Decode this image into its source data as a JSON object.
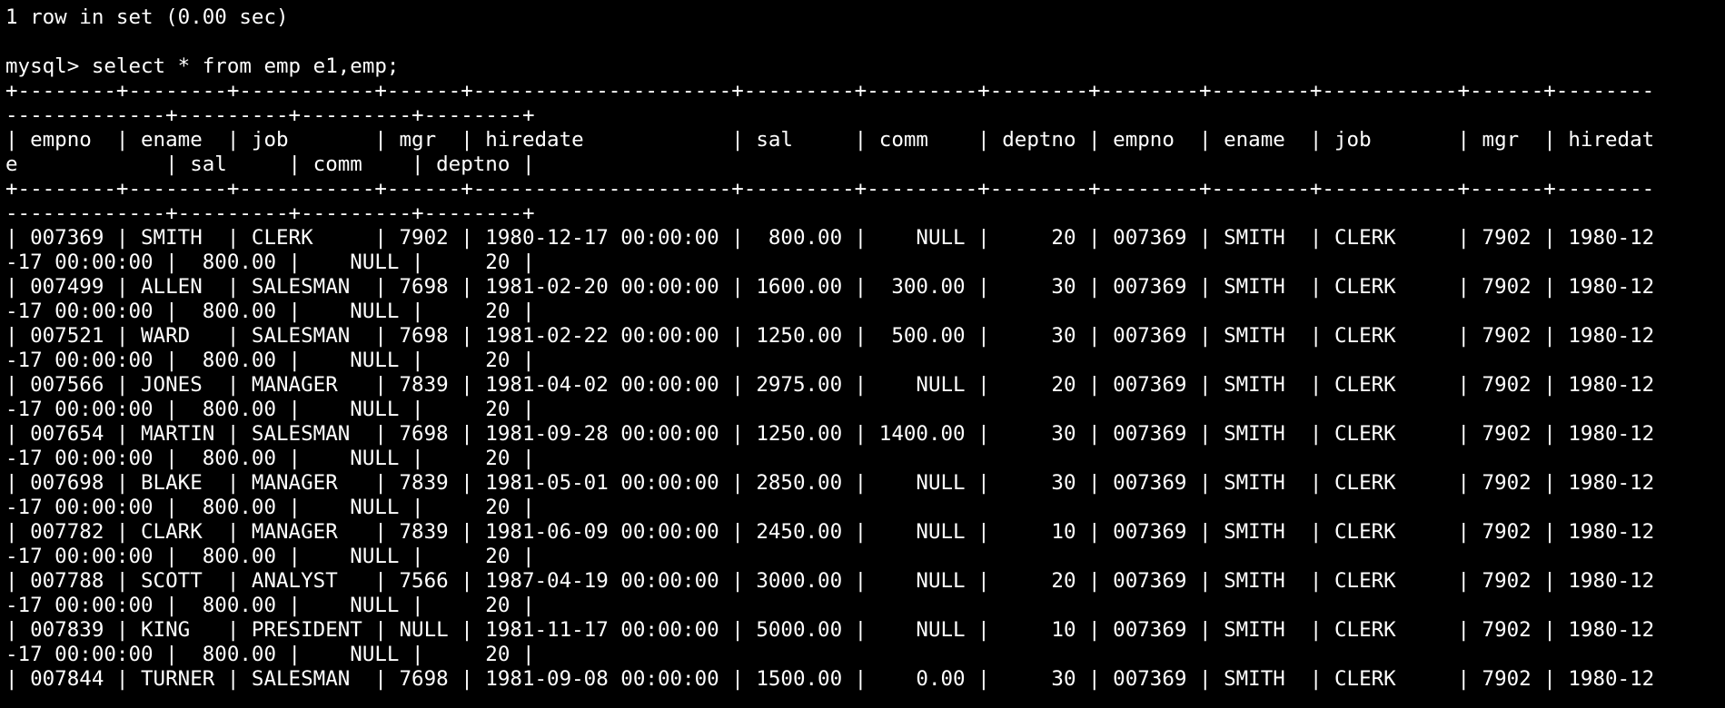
{
  "terminal": {
    "colors": {
      "background": "#000000",
      "text": "#ffffff"
    },
    "lines": [
      "1 row in set (0.00 sec)",
      "",
      "mysql> select * from emp e1,emp;",
      "+--------+--------+-----------+------+---------------------+---------+---------+--------+--------+--------+-----------+------+--------",
      "-------------+---------+---------+--------+",
      "| empno  | ename  | job       | mgr  | hiredate            | sal     | comm    | deptno | empno  | ename  | job       | mgr  | hiredat",
      "e            | sal     | comm    | deptno |",
      "+--------+--------+-----------+------+---------------------+---------+---------+--------+--------+--------+-----------+------+--------",
      "-------------+---------+---------+--------+",
      "| 007369 | SMITH  | CLERK     | 7902 | 1980-12-17 00:00:00 |  800.00 |    NULL |     20 | 007369 | SMITH  | CLERK     | 7902 | 1980-12",
      "-17 00:00:00 |  800.00 |    NULL |     20 |",
      "| 007499 | ALLEN  | SALESMAN  | 7698 | 1981-02-20 00:00:00 | 1600.00 |  300.00 |     30 | 007369 | SMITH  | CLERK     | 7902 | 1980-12",
      "-17 00:00:00 |  800.00 |    NULL |     20 |",
      "| 007521 | WARD   | SALESMAN  | 7698 | 1981-02-22 00:00:00 | 1250.00 |  500.00 |     30 | 007369 | SMITH  | CLERK     | 7902 | 1980-12",
      "-17 00:00:00 |  800.00 |    NULL |     20 |",
      "| 007566 | JONES  | MANAGER   | 7839 | 1981-04-02 00:00:00 | 2975.00 |    NULL |     20 | 007369 | SMITH  | CLERK     | 7902 | 1980-12",
      "-17 00:00:00 |  800.00 |    NULL |     20 |",
      "| 007654 | MARTIN | SALESMAN  | 7698 | 1981-09-28 00:00:00 | 1250.00 | 1400.00 |     30 | 007369 | SMITH  | CLERK     | 7902 | 1980-12",
      "-17 00:00:00 |  800.00 |    NULL |     20 |",
      "| 007698 | BLAKE  | MANAGER   | 7839 | 1981-05-01 00:00:00 | 2850.00 |    NULL |     30 | 007369 | SMITH  | CLERK     | 7902 | 1980-12",
      "-17 00:00:00 |  800.00 |    NULL |     20 |",
      "| 007782 | CLARK  | MANAGER   | 7839 | 1981-06-09 00:00:00 | 2450.00 |    NULL |     10 | 007369 | SMITH  | CLERK     | 7902 | 1980-12",
      "-17 00:00:00 |  800.00 |    NULL |     20 |",
      "| 007788 | SCOTT  | ANALYST   | 7566 | 1987-04-19 00:00:00 | 3000.00 |    NULL |     20 | 007369 | SMITH  | CLERK     | 7902 | 1980-12",
      "-17 00:00:00 |  800.00 |    NULL |     20 |",
      "| 007839 | KING   | PRESIDENT | NULL | 1981-11-17 00:00:00 | 5000.00 |    NULL |     10 | 007369 | SMITH  | CLERK     | 7902 | 1980-12",
      "-17 00:00:00 |  800.00 |    NULL |     20 |",
      "| 007844 | TURNER | SALESMAN  | 7698 | 1981-09-08 00:00:00 | 1500.00 |    0.00 |     30 | 007369 | SMITH  | CLERK     | 7902 | 1980-12"
    ]
  }
}
